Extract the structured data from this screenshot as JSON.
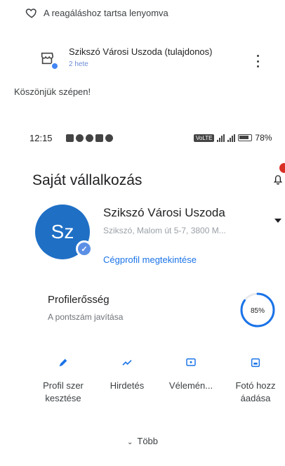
{
  "comment": {
    "react_hint": "A reagáláshoz tartsa lenyomva",
    "reply_author": "Szikszó Városi Uszoda (tulajdonos)",
    "reply_time": "2 hete",
    "reply_text": "Köszönjük szépen!"
  },
  "status_bar": {
    "time": "12:15",
    "battery": "78%"
  },
  "header": {
    "title": "Saját vállalkozás"
  },
  "business": {
    "avatar_initials": "Sz",
    "name": "Szikszó Városi Uszoda",
    "address": "Szikszó, Malom út 5-7, 3800 M...",
    "view_profile": "Cégprofil megtekintése"
  },
  "strength": {
    "title": "Profilerősség",
    "subtitle": "A pontszám javítása",
    "percent_label": "85%",
    "percent": 85
  },
  "actions": [
    {
      "label": "Profil szer\nkesztése",
      "icon": "edit-pencil-icon"
    },
    {
      "label": "Hirdetés",
      "icon": "trending-up-icon"
    },
    {
      "label": "Vélemén...",
      "icon": "review-icon"
    },
    {
      "label": "Fotó hozz\náadása",
      "icon": "photo-icon"
    }
  ],
  "more": {
    "label": "Több"
  },
  "colors": {
    "accent": "#1a73e8",
    "avatar": "#1f6fc5",
    "badge": "#d93025"
  }
}
